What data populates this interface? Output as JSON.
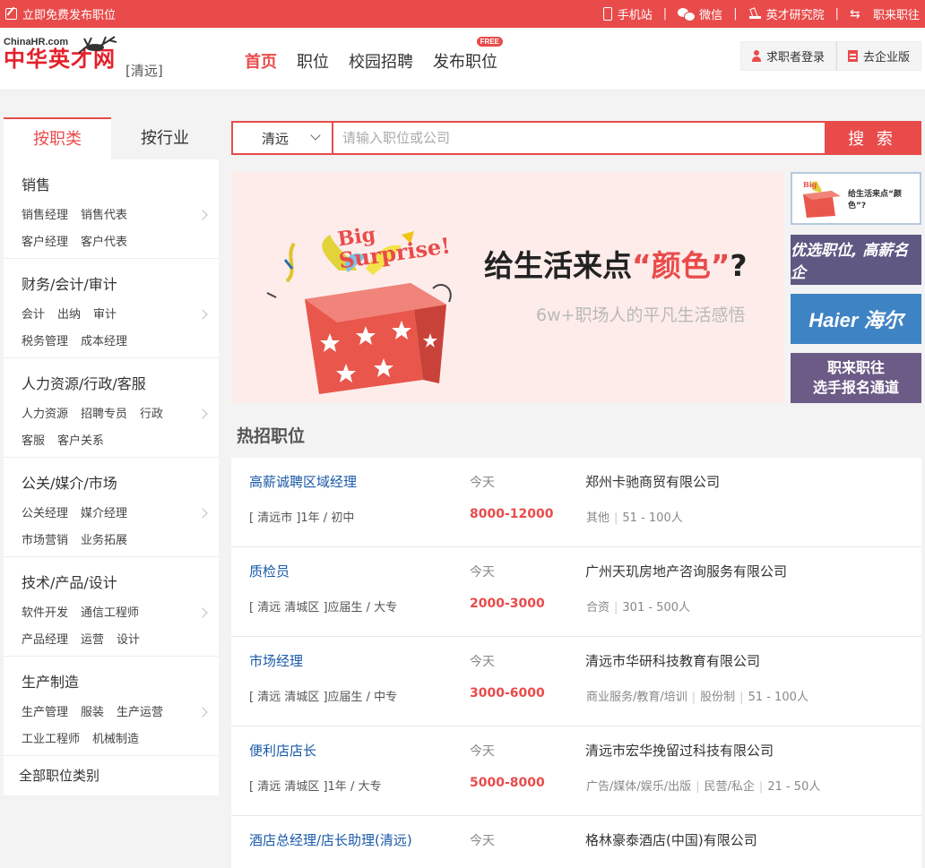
{
  "topbar": {
    "post_job": "立即免费发布职位",
    "links": [
      {
        "icon": "phone-icon",
        "label": "手机站"
      },
      {
        "icon": "wechat-icon",
        "label": "微信"
      },
      {
        "icon": "research-icon",
        "label": "英才研究院"
      },
      {
        "icon": "swap-arrows-icon",
        "label": "职来职往"
      }
    ],
    "separator": "|"
  },
  "header": {
    "logo_en": "ChinaHR.com",
    "logo_cn": "中华英才网",
    "city": "[清远]",
    "nav": [
      "首页",
      "职位",
      "校园招聘",
      "发布职位"
    ],
    "free_badge": "FREE",
    "login": "求职者登录",
    "enterprise": "去企业版"
  },
  "sidebar": {
    "tabs": [
      "按职类",
      "按行业"
    ],
    "categories": [
      {
        "title": "销售",
        "rows": [
          [
            "销售经理",
            "销售代表"
          ],
          [
            "客户经理",
            "客户代表"
          ]
        ]
      },
      {
        "title": "财务/会计/审计",
        "rows": [
          [
            "会计",
            "出纳",
            "审计"
          ],
          [
            "税务管理",
            "成本经理"
          ]
        ]
      },
      {
        "title": "人力资源/行政/客服",
        "rows": [
          [
            "人力资源",
            "招聘专员",
            "行政"
          ],
          [
            "客服",
            "客户关系"
          ]
        ]
      },
      {
        "title": "公关/媒介/市场",
        "rows": [
          [
            "公关经理",
            "媒介经理"
          ],
          [
            "市场营销",
            "业务拓展"
          ]
        ]
      },
      {
        "title": "技术/产品/设计",
        "rows": [
          [
            "软件开发",
            "通信工程师"
          ],
          [
            "产品经理",
            "运营",
            "设计"
          ]
        ]
      },
      {
        "title": "生产制造",
        "rows": [
          [
            "生产管理",
            "服装",
            "生产运营"
          ],
          [
            "工业工程师",
            "机械制造"
          ]
        ]
      }
    ],
    "all_categories": "全部职位类别"
  },
  "search": {
    "city": "清远",
    "placeholder": "请输入职位或公司",
    "button": "搜 索"
  },
  "banner": {
    "big": "Big",
    "surprise": "Surprise!",
    "headline_pre": "给生活来点",
    "headline_accent": "“颜色”",
    "headline_post": "?",
    "sub": "6w+职场人的平凡生活感悟"
  },
  "thumbs": {
    "t1": "给生活来点“颜色”?",
    "t2": "优选职位, 高薪名企",
    "t3": "Haier 海尔",
    "t4_line1": "职来职往",
    "t4_line2": "选手报名通道"
  },
  "hot_title": "热招职位",
  "jobs": [
    {
      "name": "高薪诚聘区域经理",
      "date": "今天",
      "company": "郑州卡驰商贸有限公司",
      "loc": "[ 清远市 ]1年 / 初中",
      "salary": "8000-12000",
      "meta": [
        "其他",
        "51 - 100人"
      ]
    },
    {
      "name": "质检员",
      "date": "今天",
      "company": "广州天玑房地产咨询服务有限公司",
      "loc": "[ 清远 清城区 ]应届生 / 大专",
      "salary": "2000-3000",
      "meta": [
        "合资",
        "301 - 500人"
      ]
    },
    {
      "name": "市场经理",
      "date": "今天",
      "company": "清远市华研科技教育有限公司",
      "loc": "[ 清远 清城区 ]应届生 / 中专",
      "salary": "3000-6000",
      "meta": [
        "商业服务/教育/培训",
        "股份制",
        "51 - 100人"
      ]
    },
    {
      "name": "便利店店长",
      "date": "今天",
      "company": "清远市宏华挽留过科技有限公司",
      "loc": "[ 清远 清城区 ]1年 / 大专",
      "salary": "5000-8000",
      "meta": [
        "广告/媒体/娱乐/出版",
        "民营/私企",
        "21 - 50人"
      ]
    },
    {
      "name": "酒店总经理/店长助理(清远)",
      "date": "今天",
      "company": "格林豪泰酒店(中国)有限公司",
      "loc": "",
      "salary": "",
      "meta": []
    }
  ]
}
